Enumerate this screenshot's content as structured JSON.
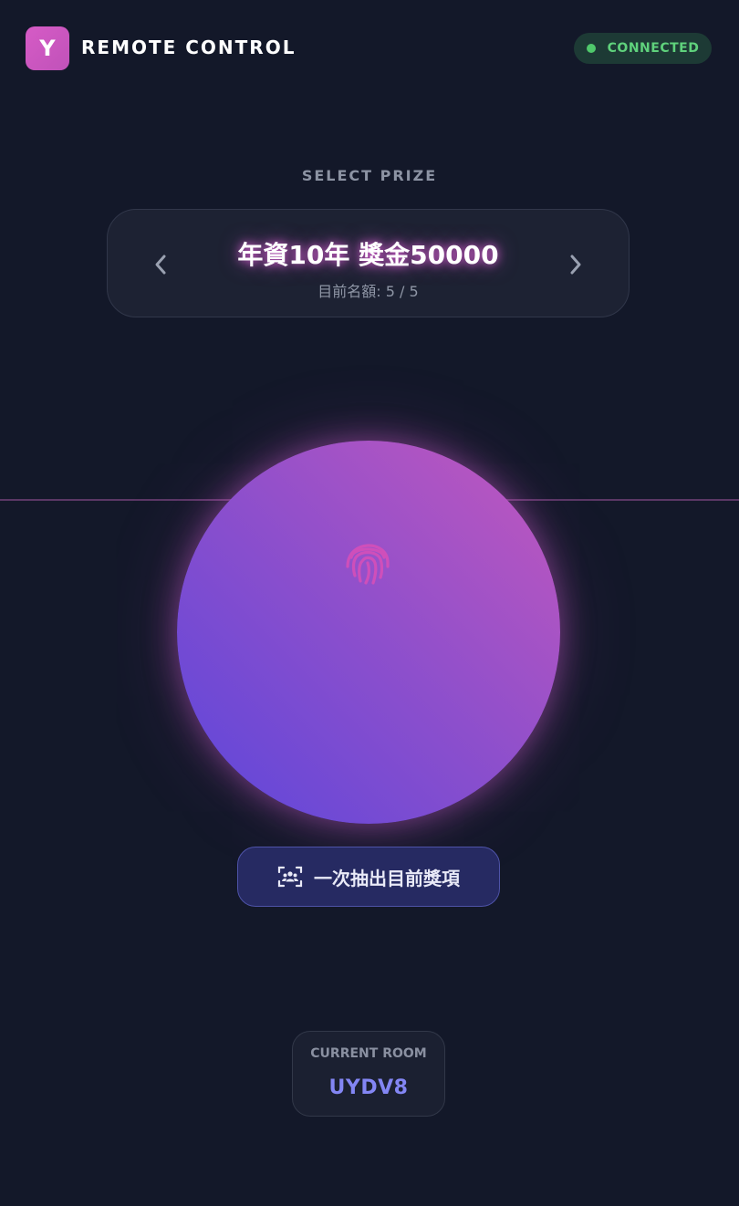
{
  "header": {
    "logo_letter": "Y",
    "app_title": "REMOTE CONTROL",
    "status": {
      "label": "CONNECTED",
      "color": "#5fd27c"
    }
  },
  "prize_selector": {
    "section_label": "SELECT PRIZE",
    "prize_name": "年資10年 獎金50000",
    "quota_text": "目前名額: 5 / 5",
    "prev_icon": "chevron-left-icon",
    "next_icon": "chevron-right-icon"
  },
  "draw_button": {
    "icon": "fingerprint-icon",
    "gradient_colors": [
      "#5b46db",
      "#c358bd"
    ]
  },
  "draw_all": {
    "icon": "group-scan-icon",
    "label": "一次抽出目前獎項"
  },
  "room": {
    "label": "CURRENT ROOM",
    "code": "UYDV8"
  },
  "colors": {
    "background": "#131829",
    "accent": "#c052b9",
    "room_code": "#8386f4"
  }
}
